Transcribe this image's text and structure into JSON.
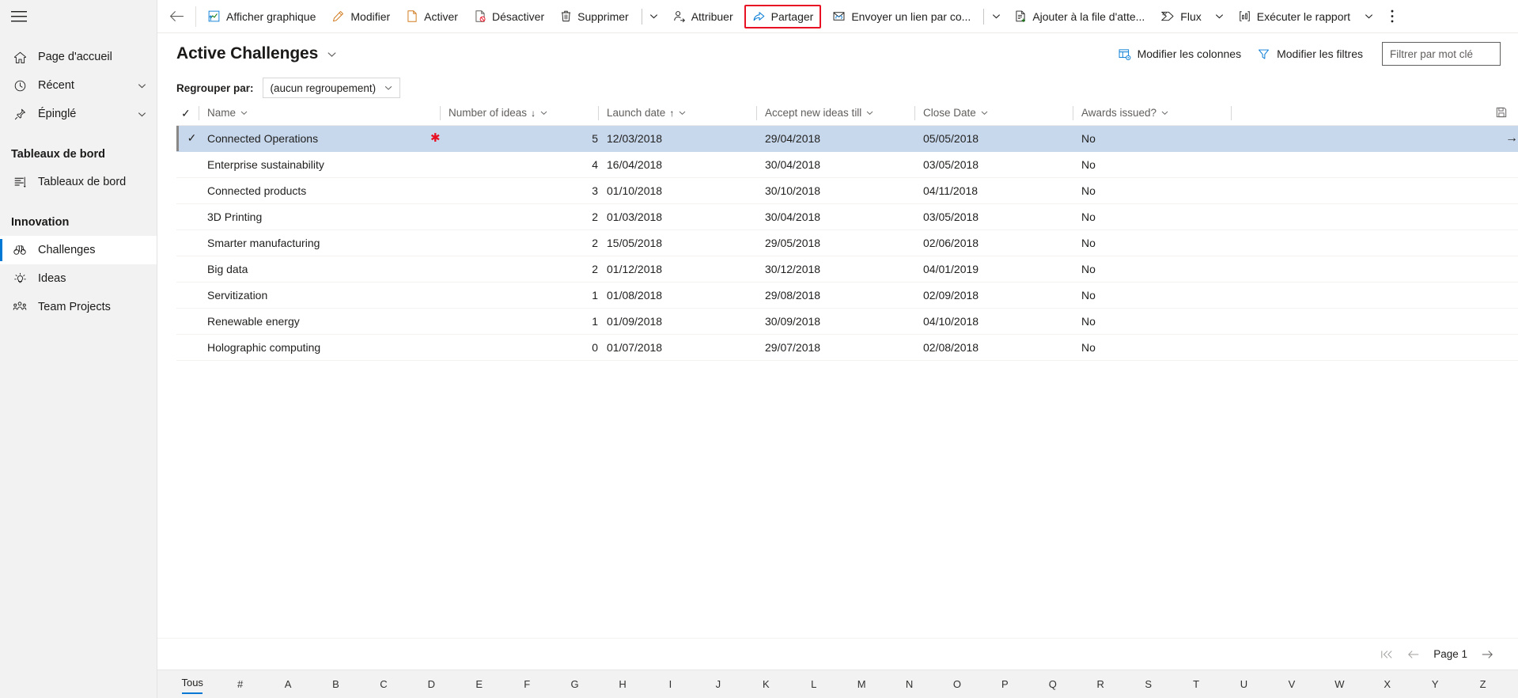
{
  "sidebar": {
    "hamburger": "menu-icon",
    "items": [
      {
        "label": "Page d'accueil",
        "icon": "home-icon",
        "expandable": false,
        "selected": false
      },
      {
        "label": "Récent",
        "icon": "clock-icon",
        "expandable": true,
        "selected": false
      },
      {
        "label": "Épinglé",
        "icon": "pin-icon",
        "expandable": true,
        "selected": false
      }
    ],
    "group1_title": "Tableaux de bord",
    "group1_items": [
      {
        "label": "Tableaux de bord",
        "icon": "dashboard-icon",
        "selected": false
      }
    ],
    "group2_title": "Innovation",
    "group2_items": [
      {
        "label": "Challenges",
        "icon": "binoculars-icon",
        "selected": true
      },
      {
        "label": "Ideas",
        "icon": "lightbulb-icon",
        "selected": false
      },
      {
        "label": "Team Projects",
        "icon": "people-icon",
        "selected": false
      }
    ]
  },
  "commandbar": {
    "back": "back-arrow-icon",
    "buttons": [
      {
        "label": "Afficher graphique",
        "icon": "chart-icon",
        "caret": false,
        "divider_after": false,
        "highlighted": false
      },
      {
        "label": "Modifier",
        "icon": "pencil-icon",
        "caret": false,
        "divider_after": false,
        "highlighted": false
      },
      {
        "label": "Activer",
        "icon": "activate-icon",
        "caret": false,
        "divider_after": false,
        "highlighted": false
      },
      {
        "label": "Désactiver",
        "icon": "deactivate-icon",
        "caret": false,
        "divider_after": false,
        "highlighted": false
      },
      {
        "label": "Supprimer",
        "icon": "trash-icon",
        "caret": true,
        "divider_after": true,
        "highlighted": false
      },
      {
        "label": "Attribuer",
        "icon": "assign-user-icon",
        "caret": false,
        "divider_after": false,
        "highlighted": false
      },
      {
        "label": "Partager",
        "icon": "share-icon",
        "caret": false,
        "divider_after": false,
        "highlighted": true
      },
      {
        "label": "Envoyer un lien par co...",
        "icon": "email-link-icon",
        "caret": true,
        "divider_after": true,
        "highlighted": false
      },
      {
        "label": "Ajouter à la file d'atte...",
        "icon": "add-queue-icon",
        "caret": false,
        "divider_after": false,
        "highlighted": false
      },
      {
        "label": "Flux",
        "icon": "flow-icon",
        "caret": true,
        "divider_after": false,
        "highlighted": false
      },
      {
        "label": "Exécuter le rapport",
        "icon": "report-icon",
        "caret": true,
        "divider_after": false,
        "highlighted": false
      }
    ],
    "overflow": "more-vertical-icon",
    "highlight_color": "#e81123"
  },
  "view": {
    "title": "Active Challenges",
    "title_caret": "chevron-down-icon",
    "edit_columns": "Modifier les colonnes",
    "edit_columns_icon": "columns-icon",
    "edit_filters": "Modifier les filtres",
    "edit_filters_icon": "filter-icon",
    "search_placeholder": "Filtrer par mot clé",
    "search_value": ""
  },
  "groupby": {
    "label": "Regrouper par:",
    "value": "(aucun regroupement)",
    "caret": "chevron-down-icon"
  },
  "grid": {
    "columns": [
      {
        "label": "Name",
        "sort": "",
        "align": "left"
      },
      {
        "label": "Number of ideas",
        "sort": "desc",
        "align": "right"
      },
      {
        "label": "Launch date",
        "sort": "asc",
        "align": "left"
      },
      {
        "label": "Accept new ideas till",
        "sort": "",
        "align": "left"
      },
      {
        "label": "Close Date",
        "sort": "",
        "align": "left"
      },
      {
        "label": "Awards issued?",
        "sort": "",
        "align": "left"
      },
      {
        "label": "",
        "sort": "",
        "align": "left"
      }
    ],
    "sort_asc_glyph": "↑",
    "sort_desc_glyph": "↓",
    "header_check": "✓",
    "save_icon": "save-icon",
    "rows": [
      {
        "name": "Connected Operations",
        "ideas": "5",
        "launch": "12/03/2018",
        "accept": "29/04/2018",
        "close": "05/05/2018",
        "awards": "No",
        "selected": true,
        "required_flag": true
      },
      {
        "name": "Enterprise sustainability",
        "ideas": "4",
        "launch": "16/04/2018",
        "accept": "30/04/2018",
        "close": "03/05/2018",
        "awards": "No",
        "selected": false,
        "required_flag": false
      },
      {
        "name": "Connected products",
        "ideas": "3",
        "launch": "01/10/2018",
        "accept": "30/10/2018",
        "close": "04/11/2018",
        "awards": "No",
        "selected": false,
        "required_flag": false
      },
      {
        "name": "3D Printing",
        "ideas": "2",
        "launch": "01/03/2018",
        "accept": "30/04/2018",
        "close": "03/05/2018",
        "awards": "No",
        "selected": false,
        "required_flag": false
      },
      {
        "name": "Smarter manufacturing",
        "ideas": "2",
        "launch": "15/05/2018",
        "accept": "29/05/2018",
        "close": "02/06/2018",
        "awards": "No",
        "selected": false,
        "required_flag": false
      },
      {
        "name": "Big data",
        "ideas": "2",
        "launch": "01/12/2018",
        "accept": "30/12/2018",
        "close": "04/01/2019",
        "awards": "No",
        "selected": false,
        "required_flag": false
      },
      {
        "name": "Servitization",
        "ideas": "1",
        "launch": "01/08/2018",
        "accept": "29/08/2018",
        "close": "02/09/2018",
        "awards": "No",
        "selected": false,
        "required_flag": false
      },
      {
        "name": "Renewable energy",
        "ideas": "1",
        "launch": "01/09/2018",
        "accept": "30/09/2018",
        "close": "04/10/2018",
        "awards": "No",
        "selected": false,
        "required_flag": false
      },
      {
        "name": "Holographic computing",
        "ideas": "0",
        "launch": "01/07/2018",
        "accept": "29/07/2018",
        "close": "02/08/2018",
        "awards": "No",
        "selected": false,
        "required_flag": false
      }
    ],
    "row_open_arrow": "→"
  },
  "pager": {
    "first": "first-page-icon",
    "prev": "previous-page-icon",
    "label": "Page 1",
    "next": "next-page-icon"
  },
  "alphabet": {
    "all_label": "Tous",
    "letters": [
      "#",
      "A",
      "B",
      "C",
      "D",
      "E",
      "F",
      "G",
      "H",
      "I",
      "J",
      "K",
      "L",
      "M",
      "N",
      "O",
      "P",
      "Q",
      "R",
      "S",
      "T",
      "U",
      "V",
      "W",
      "X",
      "Y",
      "Z"
    ]
  },
  "colors": {
    "accent": "#0078d4",
    "selection": "#c7d8ec",
    "sidebar_bg": "#f2f2f2",
    "required_red": "#e81123"
  }
}
